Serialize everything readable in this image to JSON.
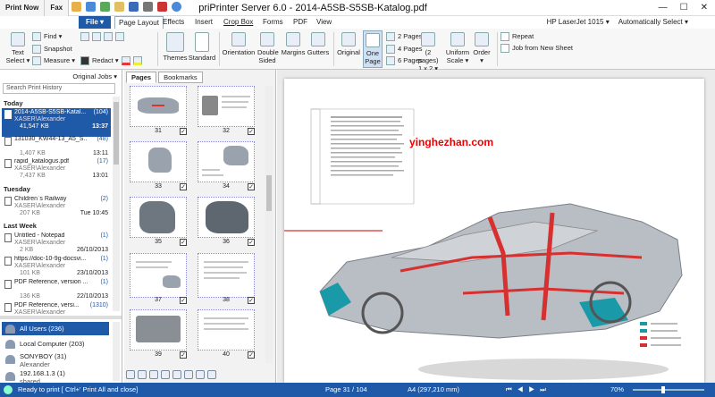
{
  "quick": {
    "print_now": "Print Now",
    "fax": "Fax"
  },
  "window": {
    "title": "priPrinter Server 6.0 - 2014-A5SB-S5SB-Katalog.pdf",
    "minimize": "—",
    "maximize": "☐",
    "close": "✕"
  },
  "tabs": {
    "file": "File ▾",
    "page_layout": "Page Layout",
    "effects": "Effects",
    "insert": "Insert",
    "crop_box": "Crop Box",
    "forms": "Forms",
    "pdf": "PDF",
    "view": "View"
  },
  "printer": {
    "name": "HP LaserJet 1015 ▾",
    "mode": "Automatically Select ▾"
  },
  "ribbon": {
    "text_select": "Text\nSelect ▾",
    "find": "Find ▾",
    "snapshot": "Snapshot",
    "measure": "Measure ▾",
    "redact": "Redact ▾",
    "themes": "Themes",
    "standard": "Standard",
    "orientation": "Orientation",
    "double_sided": "Double\nSided",
    "margins": "Margins",
    "gutters": "Gutters",
    "original": "Original",
    "one_page": "One\nPage",
    "pages2": "2 Pages",
    "pages4": "4 Pages",
    "pages6": "6 Pages",
    "pages_1x2": "(2 pages)\n1 x 2 ▾",
    "uniform_scale": "Uniform\nScale ▾",
    "order": "Order\n▾",
    "repeat": "Repeat",
    "job_new_sheet": "Job from New Sheet"
  },
  "sidebar": {
    "original_jobs": "Original Jobs ▾",
    "search_placeholder": "Search Print History",
    "groups": {
      "today": "Today",
      "tuesday": "Tuesday",
      "last_week": "Last Week"
    },
    "jobs": [
      {
        "name": "2014-A5SB-S5SB-Katal...",
        "count": "(104)",
        "user": "XASER\\Alexander",
        "size": "41,547 KB",
        "time": "13:37"
      },
      {
        "name": "131030_KW44-13_A5_S...",
        "count": "(48)",
        "user": "",
        "size": "1,407 KB",
        "time": "13:11"
      },
      {
        "name": "rapid_katalogus.pdf",
        "count": "(17)",
        "user": "XASER\\Alexander",
        "size": "7,437 KB",
        "time": "13:01"
      },
      {
        "name": "Children`s Railway",
        "count": "(2)",
        "user": "XASER\\Alexander",
        "size": "207 KB",
        "time": "Tue 10:45"
      },
      {
        "name": "Untitled - Notepad",
        "count": "(1)",
        "user": "XASER\\Alexander",
        "size": "2 KB",
        "time": "26/10/2013"
      },
      {
        "name": "https://doc-10-9g-docsvi...",
        "count": "(1)",
        "user": "XASER\\Alexander",
        "size": "101 KB",
        "time": "23/10/2013"
      },
      {
        "name": "PDF Reference, version ...",
        "count": "(1)",
        "user": "",
        "size": "136 KB",
        "time": "22/10/2013"
      },
      {
        "name": "PDF Reference, versi...",
        "count": "(1310)",
        "user": "XASER\\Alexander",
        "size": "",
        "time": ""
      }
    ],
    "users": [
      {
        "name": "All Users (236)"
      },
      {
        "name": "Local Computer (203)"
      },
      {
        "name": "SONYBOY (31)",
        "sub": "Alexander"
      },
      {
        "name": "192.168.1.3 (1)",
        "sub": "shared"
      }
    ]
  },
  "thumbs": {
    "tab_pages": "Pages",
    "tab_bookmarks": "Bookmarks",
    "pages": [
      "31",
      "32",
      "33",
      "34",
      "35",
      "36",
      "37",
      "38",
      "39",
      "40"
    ]
  },
  "viewer": {
    "watermark": "yinghezhan.com"
  },
  "status": {
    "ready": "Ready to print [ Ctrl+' Print All and close]",
    "page": "Page 31 / 104",
    "paper": "A4 (297,210 mm)",
    "zoom": "70%"
  },
  "colors": {
    "accent": "#1e5aa8",
    "car_red": "#d63030",
    "car_teal": "#1a9aa8"
  }
}
